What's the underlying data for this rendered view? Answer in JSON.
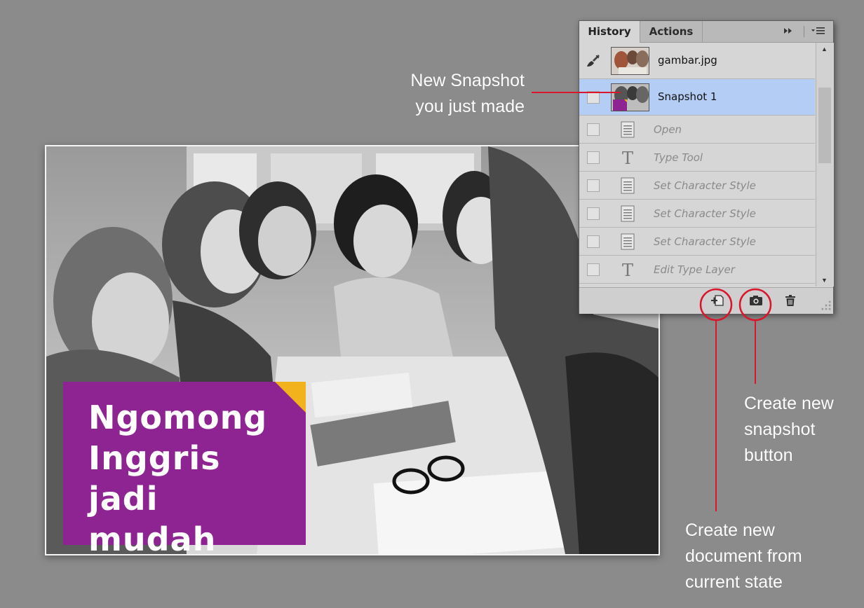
{
  "photo": {
    "promo_text": "Ngomong\nInggris jadi\nmudah",
    "promo_color": "#8e2492",
    "fold_color": "#f2b21b"
  },
  "panel": {
    "tabs": [
      {
        "label": "History",
        "active": true
      },
      {
        "label": "Actions",
        "active": false
      }
    ],
    "toolbar_icons": [
      "expand-icon",
      "panel-menu-icon"
    ],
    "snapshots": [
      {
        "label": "gambar.jpg",
        "icon": "history-brush-icon",
        "selected": false
      },
      {
        "label": "Snapshot 1",
        "icon": "checkbox",
        "selected": true
      }
    ],
    "steps": [
      {
        "label": "Open",
        "icon": "document-icon"
      },
      {
        "label": "Type Tool",
        "icon": "type-tool-icon"
      },
      {
        "label": "Set Character Style",
        "icon": "document-icon"
      },
      {
        "label": "Set Character Style",
        "icon": "document-icon"
      },
      {
        "label": "Set Character Style",
        "icon": "document-icon"
      },
      {
        "label": "Edit Type Layer",
        "icon": "type-tool-icon"
      }
    ],
    "bottom_icons": [
      "new-document-icon",
      "camera-icon",
      "trash-icon"
    ],
    "selection_color": "#b4cdf5"
  },
  "annotations": {
    "new_snapshot": "New Snapshot\nyou just made",
    "create_snapshot": "Create new\nsnapshot\nbutton",
    "create_document": "Create new\ndocument from\ncurrent state",
    "line_color": "#d9162c"
  }
}
